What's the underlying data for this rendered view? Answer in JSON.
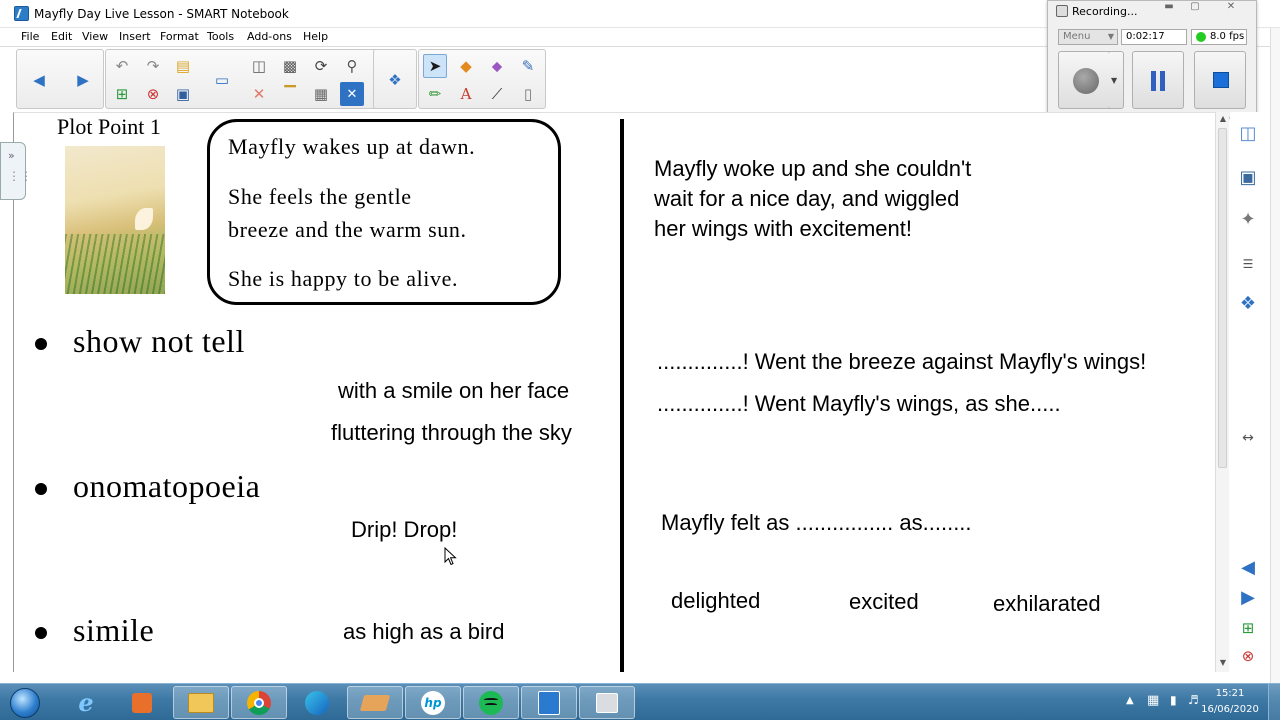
{
  "window": {
    "title": "Mayfly Day Live Lesson - SMART Notebook"
  },
  "menu": {
    "items": [
      "File",
      "Edit",
      "View",
      "Insert",
      "Format",
      "Tools",
      "Add-ons",
      "Help"
    ]
  },
  "toolbar": {
    "icons": [
      "back-arrow-icon",
      "forward-arrow-icon",
      "undo-icon",
      "redo-icon",
      "open-folder-icon",
      "add-page-icon",
      "delete-page-icon",
      "save-icon",
      "screen-shade-icon",
      "paste-icon",
      "screen-capture-icon",
      "rotate-icon",
      "magnifier-icon",
      "delete-icon",
      "insert-table-icon",
      "close-box-icon",
      "add-on-icon",
      "select-cursor-icon",
      "shapes-icon",
      "fill-icon",
      "magic-pen-icon",
      "pens-icon",
      "text-icon",
      "line-icon",
      "eraser-icon"
    ]
  },
  "recorder": {
    "title": "Recording...",
    "menu_label": "Menu",
    "elapsed": "0:02:17",
    "fps": "8.0 fps"
  },
  "lesson": {
    "plot_point": "Plot Point 1",
    "story_lines": [
      "Mayfly wakes up at dawn.",
      "She feels the gentle",
      "breeze and the warm sun.",
      "She is happy to be alive."
    ],
    "techniques": [
      {
        "label": "show not tell",
        "examples": [
          "with a smile on her face",
          "fluttering through the sky"
        ]
      },
      {
        "label": "onomatopoeia",
        "examples": [
          "Drip! Drop!"
        ]
      },
      {
        "label": "simile",
        "examples": [
          "as high as a bird"
        ]
      }
    ],
    "right": {
      "paragraph": [
        "Mayfly woke up and she couldn't",
        "wait for a nice day, and wiggled",
        "her wings with excitement!"
      ],
      "onomatopoeia_lines": [
        "..............! Went the breeze against Mayfly's wings!",
        "..............! Went Mayfly's wings, as she....."
      ],
      "simile_frame": "Mayfly felt as ................ as........",
      "word_bank": [
        "delighted",
        "excited",
        "exhilarated"
      ]
    }
  },
  "taskbar": {
    "apps": [
      "internet-explorer-icon",
      "media-player-icon",
      "file-explorer-icon",
      "chrome-icon",
      "edge-icon",
      "folder-icon",
      "hp-icon",
      "spotify-icon",
      "smart-notebook-icon",
      "recorder-icon"
    ],
    "time": "15:21",
    "date": "16/06/2020"
  }
}
